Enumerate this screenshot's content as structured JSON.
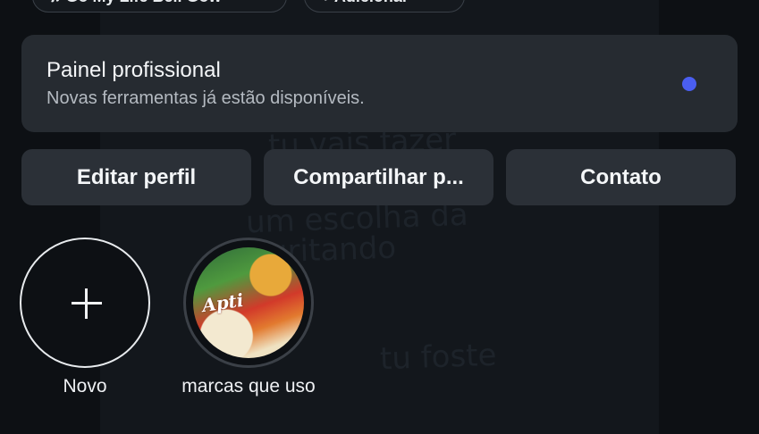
{
  "top_pills": [
    {
      "label": "♫ Go My Life Bell Gow"
    },
    {
      "label": "+ Adicionar"
    }
  ],
  "professional_panel": {
    "title": "Painel profissional",
    "subtitle": "Novas ferramentas já estão disponíveis.",
    "dot_color": "#4a5ef0"
  },
  "profile_buttons": {
    "edit": "Editar perfil",
    "share": "Compartilhar p...",
    "contact": "Contato"
  },
  "highlights": [
    {
      "label": "Novo",
      "icon": "plus-icon"
    },
    {
      "label": "marcas que uso",
      "brand_text": "Apti"
    }
  ]
}
